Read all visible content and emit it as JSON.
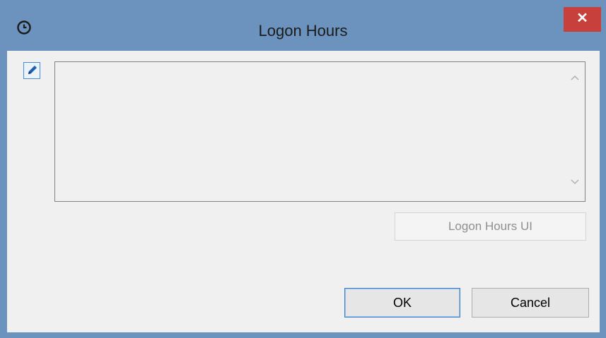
{
  "window": {
    "title": "Logon Hours",
    "close_label": "✕"
  },
  "icons": {
    "title": "clock-icon",
    "edit": "pencil-icon",
    "scroll_up": "chevron-up-icon",
    "scroll_down": "chevron-down-icon"
  },
  "content": {
    "logon_hours_value": "",
    "logon_hours_ui_label": "Logon Hours UI"
  },
  "buttons": {
    "ok_label": "OK",
    "cancel_label": "Cancel"
  },
  "colors": {
    "titlebar": "#6b93bd",
    "close": "#c7403b",
    "client": "#f0f0f0",
    "focus": "#3c7fd1"
  }
}
